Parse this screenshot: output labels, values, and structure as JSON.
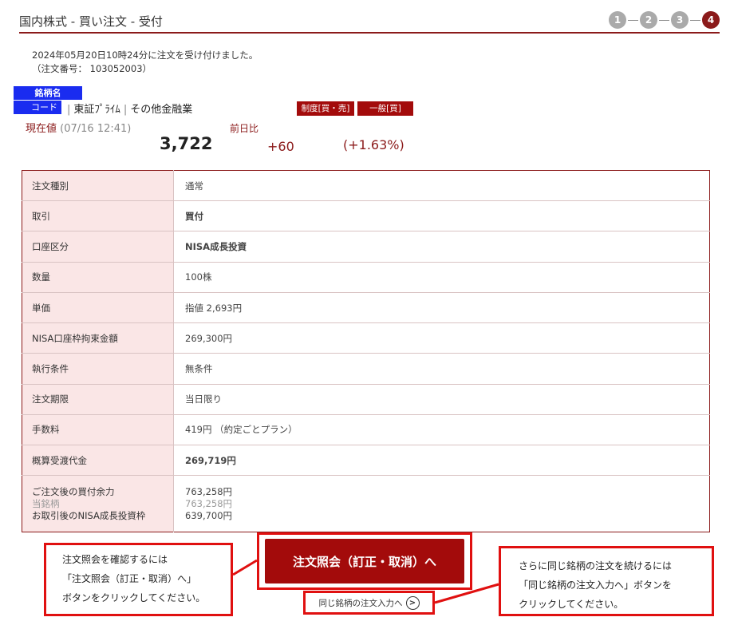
{
  "header": {
    "title": "国内株式 - 買い注文 - 受付",
    "steps": [
      "1",
      "2",
      "3",
      "4"
    ],
    "active_step": "4"
  },
  "accept": {
    "message": "2024年05月20日10時24分に注文を受け付けました。",
    "order_no": "（注文番号： 103052003）"
  },
  "stock": {
    "name_badge": "銘柄名",
    "code_badge": "コード",
    "market": "東証ﾌﾟﾗｲﾑ",
    "sector": "その他金融業",
    "tag_margin": "制度[買・売]",
    "tag_general": "一般[買]",
    "price_label": "現在値",
    "price_time": "(07/16 12:41)",
    "diff_label": "前日比",
    "price": "3,722",
    "change": "+60",
    "change_pct": "(+1.63%)"
  },
  "order": {
    "rows": [
      {
        "label": "注文種別",
        "value": "通常"
      },
      {
        "label": "取引",
        "value": "買付"
      },
      {
        "label": "口座区分",
        "value": "NISA成長投資"
      },
      {
        "label": "数量",
        "value": "100株"
      },
      {
        "label": "単価",
        "value": "指値 2,693円"
      },
      {
        "label": "NISA口座枠拘束金額",
        "value": "269,300円"
      },
      {
        "label": "執行条件",
        "value": "無条件"
      },
      {
        "label": "注文期限",
        "value": "当日限り"
      },
      {
        "label": "手数料",
        "value": "419円 （約定ごとプラン）"
      },
      {
        "label": "概算受渡代金",
        "value": "269,719円"
      }
    ],
    "last": {
      "label1": "ご注文後の買付余力",
      "label2": "当銘柄",
      "label3": "お取引後のNISA成長投資枠",
      "value1": "763,258円",
      "value2": "763,258円",
      "value3": "639,700円"
    }
  },
  "buttons": {
    "inquiry": "注文照会（訂正・取消）へ",
    "same_stock": "同じ銘柄の注文入力へ"
  },
  "notes": {
    "left": [
      "注文照会を確認するには",
      "「注文照会（訂正・取消）へ」",
      "ボタンをクリックしてください。"
    ],
    "right": [
      "さらに同じ銘柄の注文を続けるには",
      "「同じ銘柄の注文入力へ」ボタンを",
      "クリックしてください。"
    ]
  },
  "colors": {
    "accent": "#8b1a1a",
    "button": "#a30b0b",
    "badge": "#1a2cf0",
    "callout": "#e01010",
    "row_label_bg": "#fae6e6"
  }
}
